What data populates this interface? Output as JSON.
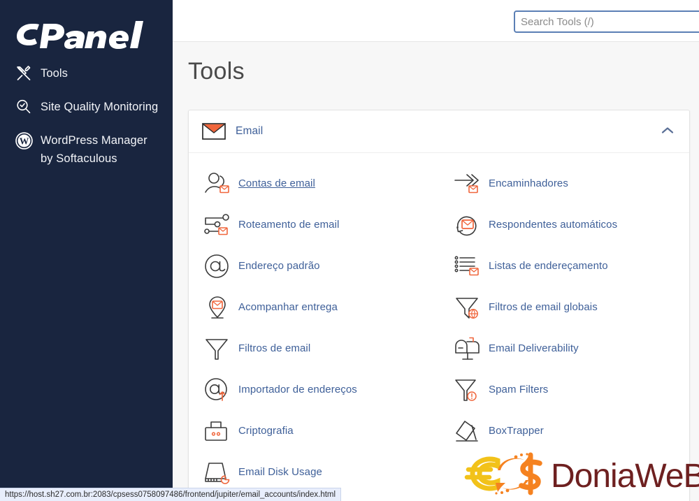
{
  "sidebar": {
    "brand": "cPanel",
    "items": [
      {
        "label": "Tools",
        "icon": "tools-icon"
      },
      {
        "label": "Site Quality Monitoring",
        "icon": "site-quality-icon"
      },
      {
        "label": "WordPress Manager by Softaculous",
        "icon": "wordpress-icon"
      }
    ]
  },
  "topbar": {
    "search": {
      "placeholder": "Search Tools (/)",
      "value": ""
    }
  },
  "main": {
    "page_title": "Tools",
    "panel": {
      "title": "Email",
      "icon": "envelope-icon",
      "collapse_icon": "chevron-up-icon",
      "expanded": true,
      "tools": [
        {
          "label": "Contas de email",
          "icon": "email-accounts-icon",
          "hovered": true
        },
        {
          "label": "Encaminhadores",
          "icon": "forwarders-icon",
          "hovered": false
        },
        {
          "label": "Roteamento de email",
          "icon": "email-routing-icon",
          "hovered": false
        },
        {
          "label": "Respondentes automáticos",
          "icon": "autoresponders-icon",
          "hovered": false
        },
        {
          "label": "Endereço padrão",
          "icon": "default-address-icon",
          "hovered": false
        },
        {
          "label": "Listas de endereçamento",
          "icon": "mailing-lists-icon",
          "hovered": false
        },
        {
          "label": "Acompanhar entrega",
          "icon": "track-delivery-icon",
          "hovered": false
        },
        {
          "label": "Filtros de email globais",
          "icon": "global-filters-icon",
          "hovered": false
        },
        {
          "label": "Filtros de email",
          "icon": "email-filters-icon",
          "hovered": false
        },
        {
          "label": "Email Deliverability",
          "icon": "deliverability-icon",
          "hovered": false
        },
        {
          "label": "Importador de endereços",
          "icon": "address-importer-icon",
          "hovered": false
        },
        {
          "label": "Spam Filters",
          "icon": "spam-filters-icon",
          "hovered": false
        },
        {
          "label": "Criptografia",
          "icon": "encryption-icon",
          "hovered": false
        },
        {
          "label": "BoxTrapper",
          "icon": "boxtrapper-icon",
          "hovered": false
        },
        {
          "label": "Email Disk Usage",
          "icon": "email-disk-usage-icon",
          "hovered": false
        }
      ]
    }
  },
  "watermark": {
    "text": "DoniaWeB",
    "currency_euro": "€",
    "currency_dollar": "$"
  },
  "statusbar": {
    "url": "https://host.sh27.com.br:2083/cpsess0758097486/frontend/jupiter/email_accounts/index.html"
  },
  "colors": {
    "sidebar_bg": "#19253f",
    "accent_orange": "#f0663c",
    "link_blue": "#3f6099",
    "page_bg": "#f7f7f7",
    "card_bg": "#ffffff",
    "watermark_maroon": "#6e2020",
    "watermark_yellow": "#f2c21a",
    "search_border": "#5b7fb5"
  }
}
